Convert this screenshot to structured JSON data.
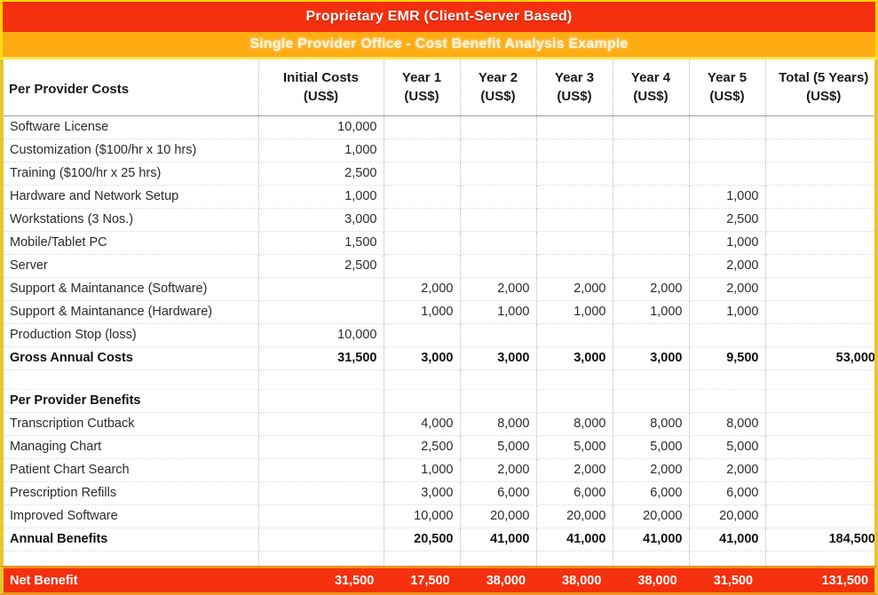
{
  "title_bands": {
    "primary": "Proprietary EMR (Client-Server Based)",
    "secondary": "Single Provider Office - Cost Benefit Analysis Example"
  },
  "colors": {
    "band_red": "#F4300E",
    "band_orange": "#FFA500",
    "border_yellow": "#E8C72B",
    "net_row_bg": "#F4300E",
    "net_row_text": "#FFFFFF"
  },
  "table": {
    "columns": [
      {
        "key": "label",
        "line1": "Per Provider Costs",
        "line2": ""
      },
      {
        "key": "initial",
        "line1": "Initial Costs",
        "line2": "(US$)"
      },
      {
        "key": "y1",
        "line1": "Year 1",
        "line2": "(US$)"
      },
      {
        "key": "y2",
        "line1": "Year 2",
        "line2": "(US$)"
      },
      {
        "key": "y3",
        "line1": "Year 3",
        "line2": "(US$)"
      },
      {
        "key": "y4",
        "line1": "Year 4",
        "line2": "(US$)"
      },
      {
        "key": "y5",
        "line1": "Year 5",
        "line2": "(US$)"
      },
      {
        "key": "total",
        "line1": "Total (5 Years)",
        "line2": "(US$)"
      }
    ],
    "rows": [
      {
        "type": "data",
        "label": "Software License",
        "initial": "10,000",
        "y1": "",
        "y2": "",
        "y3": "",
        "y4": "",
        "y5": "",
        "total": ""
      },
      {
        "type": "data",
        "label": "Customization ($100/hr x 10 hrs)",
        "initial": "1,000",
        "y1": "",
        "y2": "",
        "y3": "",
        "y4": "",
        "y5": "",
        "total": ""
      },
      {
        "type": "data",
        "label": "Training ($100/hr x 25 hrs)",
        "initial": "2,500",
        "y1": "",
        "y2": "",
        "y3": "",
        "y4": "",
        "y5": "",
        "total": ""
      },
      {
        "type": "data",
        "label": "Hardware and Network Setup",
        "initial": "1,000",
        "y1": "",
        "y2": "",
        "y3": "",
        "y4": "",
        "y5": "1,000",
        "total": ""
      },
      {
        "type": "data",
        "label": "Workstations (3 Nos.)",
        "initial": "3,000",
        "y1": "",
        "y2": "",
        "y3": "",
        "y4": "",
        "y5": "2,500",
        "total": ""
      },
      {
        "type": "data",
        "label": "Mobile/Tablet PC",
        "initial": "1,500",
        "y1": "",
        "y2": "",
        "y3": "",
        "y4": "",
        "y5": "1,000",
        "total": ""
      },
      {
        "type": "data",
        "label": "Server",
        "initial": "2,500",
        "y1": "",
        "y2": "",
        "y3": "",
        "y4": "",
        "y5": "2,000",
        "total": ""
      },
      {
        "type": "data",
        "label": "Support & Maintanance (Software)",
        "initial": "",
        "y1": "2,000",
        "y2": "2,000",
        "y3": "2,000",
        "y4": "2,000",
        "y5": "2,000",
        "total": ""
      },
      {
        "type": "data",
        "label": "Support & Maintanance (Hardware)",
        "initial": "",
        "y1": "1,000",
        "y2": "1,000",
        "y3": "1,000",
        "y4": "1,000",
        "y5": "1,000",
        "total": ""
      },
      {
        "type": "data",
        "label": "Production Stop (loss)",
        "initial": "10,000",
        "y1": "",
        "y2": "",
        "y3": "",
        "y4": "",
        "y5": "",
        "total": ""
      },
      {
        "type": "total",
        "label": "Gross Annual Costs",
        "initial": "31,500",
        "y1": "3,000",
        "y2": "3,000",
        "y3": "3,000",
        "y4": "3,000",
        "y5": "9,500",
        "total": "53,000"
      },
      {
        "type": "spacer",
        "label": "",
        "initial": "",
        "y1": "",
        "y2": "",
        "y3": "",
        "y4": "",
        "y5": "",
        "total": ""
      },
      {
        "type": "section",
        "label": "Per Provider Benefits",
        "initial": "",
        "y1": "",
        "y2": "",
        "y3": "",
        "y4": "",
        "y5": "",
        "total": ""
      },
      {
        "type": "data",
        "label": "Transcription Cutback",
        "initial": "",
        "y1": "4,000",
        "y2": "8,000",
        "y3": "8,000",
        "y4": "8,000",
        "y5": "8,000",
        "total": ""
      },
      {
        "type": "data",
        "label": "Managing Chart",
        "initial": "",
        "y1": "2,500",
        "y2": "5,000",
        "y3": "5,000",
        "y4": "5,000",
        "y5": "5,000",
        "total": ""
      },
      {
        "type": "data",
        "label": "Patient Chart Search",
        "initial": "",
        "y1": "1,000",
        "y2": "2,000",
        "y3": "2,000",
        "y4": "2,000",
        "y5": "2,000",
        "total": ""
      },
      {
        "type": "data",
        "label": "Prescription Refills",
        "initial": "",
        "y1": "3,000",
        "y2": "6,000",
        "y3": "6,000",
        "y4": "6,000",
        "y5": "6,000",
        "total": ""
      },
      {
        "type": "data",
        "label": "Improved Software",
        "initial": "",
        "y1": "10,000",
        "y2": "20,000",
        "y3": "20,000",
        "y4": "20,000",
        "y5": "20,000",
        "total": ""
      },
      {
        "type": "total",
        "label": "Annual Benefits",
        "initial": "",
        "y1": "20,500",
        "y2": "41,000",
        "y3": "41,000",
        "y4": "41,000",
        "y5": "41,000",
        "total": "184,500"
      },
      {
        "type": "spacer",
        "label": "",
        "initial": "",
        "y1": "",
        "y2": "",
        "y3": "",
        "y4": "",
        "y5": "",
        "total": ""
      }
    ]
  },
  "net_benefit": {
    "label": "Net Benefit",
    "initial": "31,500",
    "y1": "17,500",
    "y2": "38,000",
    "y3": "38,000",
    "y4": "38,000",
    "y5": "31,500",
    "total": "131,500"
  }
}
